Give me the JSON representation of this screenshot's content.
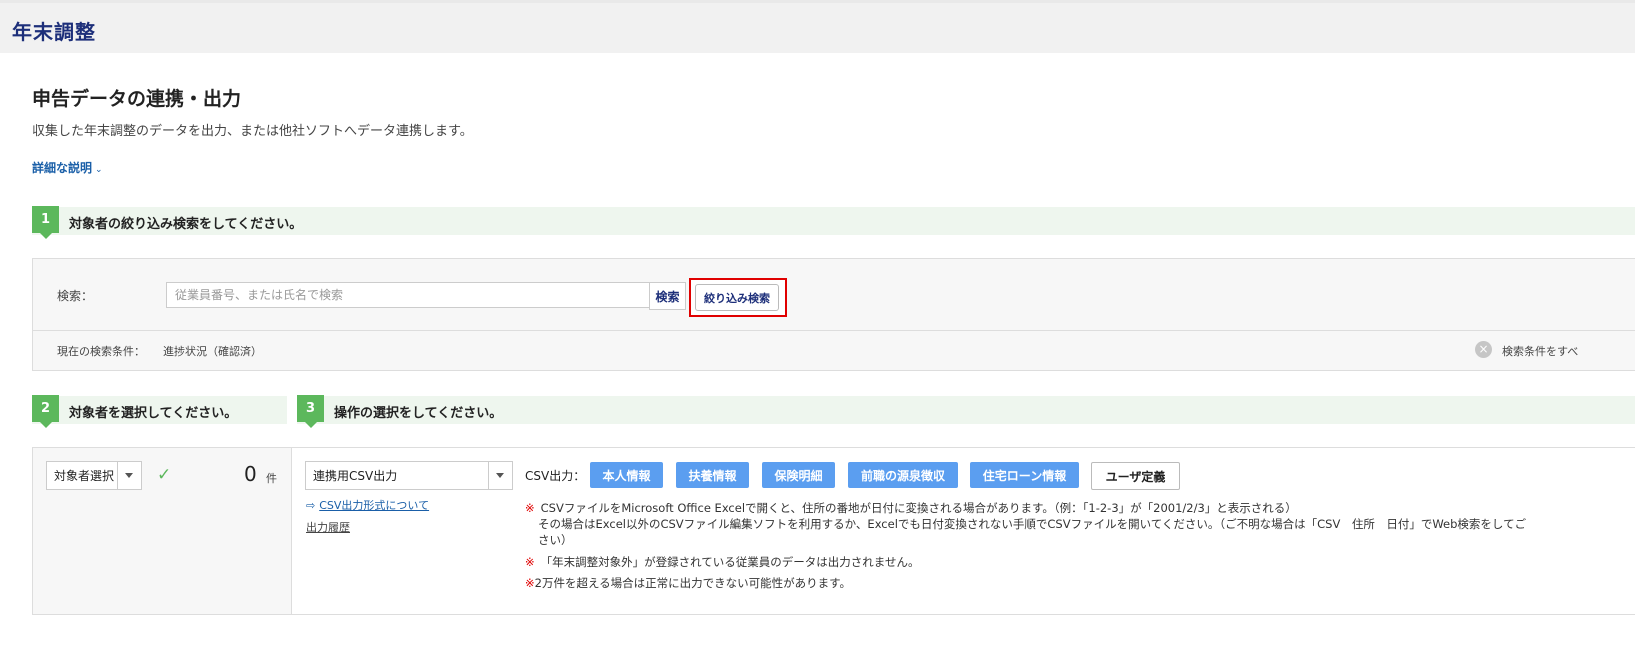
{
  "header": {
    "title": "年末調整"
  },
  "page": {
    "title": "申告データの連携・出力",
    "description": "収集した年末調整のデータを出力、または他社ソフトへデータ連携します。",
    "detail_link": "詳細な説明"
  },
  "steps": {
    "step1": {
      "number": "1",
      "label": "対象者の絞り込み検索をしてください。"
    },
    "step2": {
      "number": "2",
      "label": "対象者を選択してください。"
    },
    "step3": {
      "number": "3",
      "label": "操作の選択をしてください。"
    }
  },
  "search": {
    "label": "検索：",
    "placeholder": "従業員番号、または氏名で検索",
    "search_button": "検索",
    "filter_button": "絞り込み検索",
    "condition_label": "現在の検索条件：",
    "condition_value": "進捗状況（確認済）",
    "clear_label": "検索条件をすべ"
  },
  "selection": {
    "select_label": "対象者選択",
    "count": "0",
    "count_unit": "件"
  },
  "operation": {
    "select_value": "連携用CSV出力",
    "csv_format_link": "CSV出力形式について",
    "history_link": "出力履歴",
    "csv_label": "CSV出力：",
    "buttons": [
      "本人情報",
      "扶養情報",
      "保険明細",
      "前職の源泉徴収",
      "住宅ローン情報",
      "ユーザ定義"
    ],
    "notes": {
      "mark": "※",
      "note1_line1": "CSVファイルをMicrosoft Office Excelで開くと、住所の番地が日付に変換される場合があります。（例：「1-2-3」が「2001/2/3」と表示される）",
      "note1_line2": "その場合はExcel以外のCSVファイル編集ソフトを利用するか、Excelでも日付変換されない手順でCSVファイルを開いてください。（ご不明な場合は「CSV　住所　日付」でWeb検索をしてご",
      "note1_line3": "さい）",
      "note2": "「年末調整対象外」が登録されている従業員のデータは出力されません。",
      "note3": "2万件を超える場合は正常に出力できない可能性があります。"
    }
  },
  "colors": {
    "brand": "#1d2f7a",
    "step": "#5cb85c",
    "button": "#5b9ef0",
    "alert": "#e00000"
  }
}
